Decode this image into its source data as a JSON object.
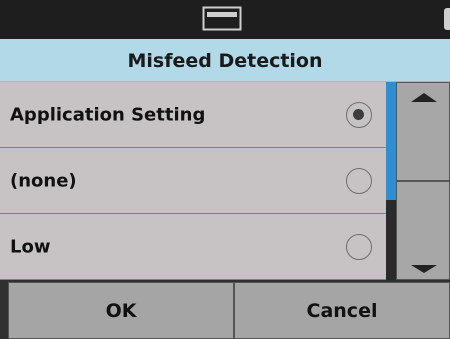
{
  "header": {
    "title": "Misfeed Detection"
  },
  "statusbar": {
    "icon": "scanner-tray-icon"
  },
  "options": [
    {
      "label": "Application Setting",
      "selected": true
    },
    {
      "label": "(none)",
      "selected": false
    },
    {
      "label": "Low",
      "selected": false
    }
  ],
  "footer": {
    "ok_label": "OK",
    "cancel_label": "Cancel"
  },
  "colors": {
    "title_bar": "#b2d9e8",
    "list_background": "#c7c3c5",
    "divider": "#3c97c8",
    "scroll_thumb": "#2f8dd1",
    "button": "#a5a5a5"
  }
}
